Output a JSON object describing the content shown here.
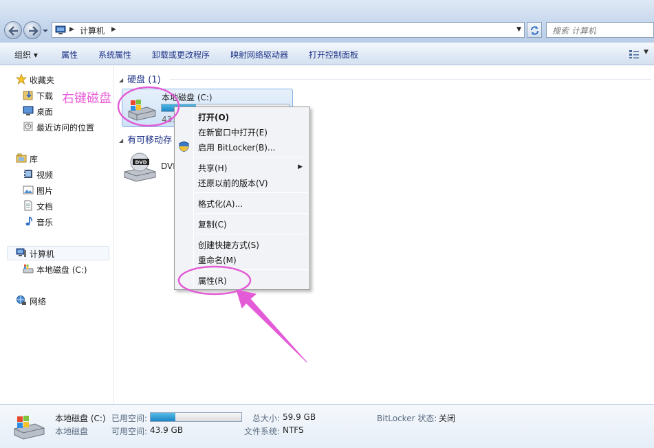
{
  "address": {
    "crumb": "计算机",
    "search_placeholder": "搜索 计算机"
  },
  "toolbar": {
    "items": [
      "组织 ▾",
      "属性",
      "系统属性",
      "卸载或更改程序",
      "映射网络驱动器",
      "打开控制面板"
    ]
  },
  "navpane": {
    "favorites": "收藏夹",
    "downloads": "下载",
    "desktop": "桌面",
    "recent": "最近访问的位置",
    "libraries": "库",
    "videos": "视频",
    "pictures": "图片",
    "documents": "文档",
    "music": "音乐",
    "computer": "计算机",
    "local_disk": "本地磁盘 (C:)",
    "network": "网络"
  },
  "content": {
    "group_hdd": "硬盘 (1)",
    "group_removable": "有可移动存",
    "drive_name": "本地磁盘 (C:)",
    "drive_free": "43.",
    "drive_used_fraction": 0.27,
    "dvd_name": "DVI"
  },
  "annotation": {
    "text": "右键磁盘",
    "color": "#e85fd8"
  },
  "context_menu": {
    "items": [
      {
        "label": "打开(O)",
        "bold": true
      },
      {
        "label": "在新窗口中打开(E)"
      },
      {
        "label": "启用 BitLocker(B)..."
      },
      {
        "label": "共享(H)",
        "submenu": true
      },
      {
        "label": "还原以前的版本(V)"
      },
      {
        "label": "格式化(A)..."
      },
      {
        "label": "复制(C)"
      },
      {
        "label": "创建快捷方式(S)"
      },
      {
        "label": "重命名(M)"
      },
      {
        "label": "属性(R)"
      }
    ]
  },
  "details": {
    "name": "本地磁盘 (C:)",
    "type": "本地磁盘",
    "used_label": "已用空间:",
    "free_label": "可用空间:",
    "free_value": "43.9 GB",
    "total_label": "总大小:",
    "total_value": "59.9 GB",
    "fs_label": "文件系统:",
    "fs_value": "NTFS",
    "bitlocker_label": "BitLocker 状态:",
    "bitlocker_value": "关闭",
    "used_fraction": 0.27
  }
}
